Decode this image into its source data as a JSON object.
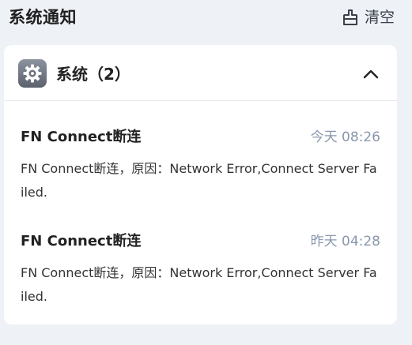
{
  "header": {
    "title": "系统通知",
    "clear_label": "清空"
  },
  "group": {
    "title": "系统（2）",
    "app_icon": "gear-icon",
    "collapse_icon": "chevron-up-icon"
  },
  "notifications": [
    {
      "title": "FN Connect断连",
      "time": "今天 08:26",
      "body": "FN Connect断连，原因：Network Error,Connect Server Failed."
    },
    {
      "title": "FN Connect断连",
      "time": "昨天 04:28",
      "body": "FN Connect断连，原因：Network Error,Connect Server Failed."
    }
  ],
  "colors": {
    "background": "#eef1f6",
    "card": "#ffffff",
    "time_text": "#8a97ad"
  }
}
